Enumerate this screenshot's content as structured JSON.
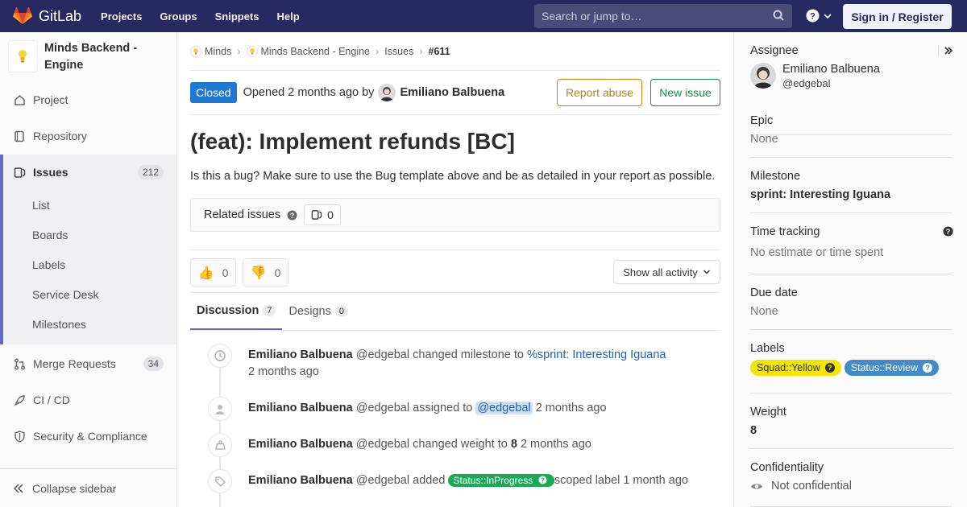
{
  "topbar": {
    "brand": "GitLab",
    "nav": [
      "Projects",
      "Groups",
      "Snippets",
      "Help"
    ],
    "search_placeholder": "Search or jump to…",
    "signin": "Sign in / Register"
  },
  "sidebar": {
    "project_name": "Minds Backend - Engine",
    "items": {
      "project": "Project",
      "repository": "Repository",
      "issues": "Issues",
      "issues_count": "212",
      "list": "List",
      "boards": "Boards",
      "labels": "Labels",
      "service_desk": "Service Desk",
      "milestones": "Milestones",
      "merge_requests": "Merge Requests",
      "mr_count": "34",
      "cicd": "CI / CD",
      "security": "Security & Compliance"
    },
    "collapse": "Collapse sidebar"
  },
  "breadcrumb": [
    "Minds",
    "Minds Backend - Engine",
    "Issues",
    "#611"
  ],
  "issue": {
    "status": "Closed",
    "opened": "Opened 2 months ago by",
    "author": "Emiliano Balbuena",
    "report_abuse": "Report abuse",
    "new_issue": "New issue",
    "title": "(feat): Implement refunds [BC]",
    "description": "Is this a bug? Make sure to use the Bug template above and be as detailed in your report as possible.",
    "related_label": "Related issues",
    "related_count": "0",
    "thumbs_up": "0",
    "thumbs_down": "0",
    "activity_filter": "Show all activity",
    "tabs": [
      {
        "label": "Discussion",
        "count": "7"
      },
      {
        "label": "Designs",
        "count": "0"
      }
    ]
  },
  "timeline": [
    {
      "user": "Emiliano Balbuena",
      "handle": "@edgebal",
      "action": "changed milestone to",
      "link": "%sprint: Interesting Iguana",
      "time": "2 months ago",
      "icon": "clock-icon"
    },
    {
      "user": "Emiliano Balbuena",
      "handle": "@edgebal",
      "action": "assigned to",
      "link": "@edgebal",
      "time": "2 months ago",
      "icon": "user-icon"
    },
    {
      "user": "Emiliano Balbuena",
      "handle": "@edgebal",
      "action": "changed weight to",
      "value": "8",
      "time": "2 months ago",
      "icon": "weight-icon"
    },
    {
      "user": "Emiliano Balbuena",
      "handle": "@edgebal",
      "action": "added",
      "label": "Status::InProgress",
      "suffix": "scoped label",
      "time": "1 month ago",
      "icon": "tag-icon"
    }
  ],
  "right": {
    "assignee_title": "Assignee",
    "assignee_name": "Emiliano Balbuena",
    "assignee_handle": "@edgebal",
    "epic_title": "Epic",
    "epic_value": "None",
    "milestone_title": "Milestone",
    "milestone_value": "sprint: Interesting Iguana",
    "time_title": "Time tracking",
    "time_value": "No estimate or time spent",
    "due_title": "Due date",
    "due_value": "None",
    "labels_title": "Labels",
    "labels": [
      {
        "text": "Squad::Yellow",
        "bg": "#f5e600",
        "fg": "#333"
      },
      {
        "text": "Status::Review",
        "bg": "#428bca",
        "fg": "#fff"
      }
    ],
    "weight_title": "Weight",
    "weight_value": "8",
    "conf_title": "Confidentiality",
    "conf_value": "Not confidential"
  },
  "colors": {
    "nav_bg": "#292961",
    "closed_badge": "#1f78d1",
    "accent": "#6666c4",
    "inprogress": "#1aaa55"
  }
}
